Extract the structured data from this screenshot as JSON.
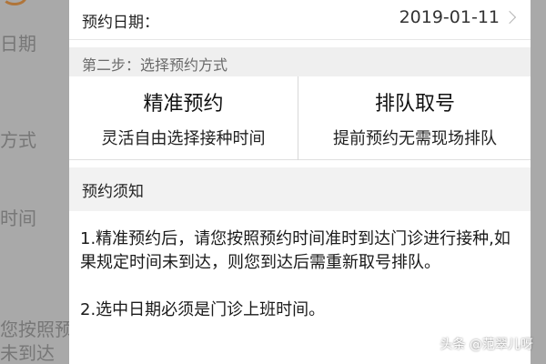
{
  "background_page": {
    "fragments": [
      "日期",
      "方式",
      "时间",
      "您按照预",
      "未到达"
    ]
  },
  "date_row": {
    "label": "预约日期：",
    "value": "2019-01-11",
    "chevron_icon": "chevron-right-icon"
  },
  "step2": {
    "title": "第二步：选择预约方式"
  },
  "options": [
    {
      "title": "精准预约",
      "subtitle": "灵活自由选择接种时间"
    },
    {
      "title": "排队取号",
      "subtitle": "提前预约无需现场排队"
    }
  ],
  "notice": {
    "title": "预约须知",
    "items": [
      "1.精准预约后，请您按照预约时间准时到达门诊进行接种,如果规定时间未到达，则您到达后需重新取号排队。",
      "2.选中日期必须是门诊上班时间。"
    ]
  },
  "watermark": "头条 @范翠儿呀",
  "colors": {
    "overlay": "#a9a9a9",
    "sheet_bg": "#ffffff",
    "section_header_bg": "#efefef",
    "accent_orange": "#b0753a"
  }
}
